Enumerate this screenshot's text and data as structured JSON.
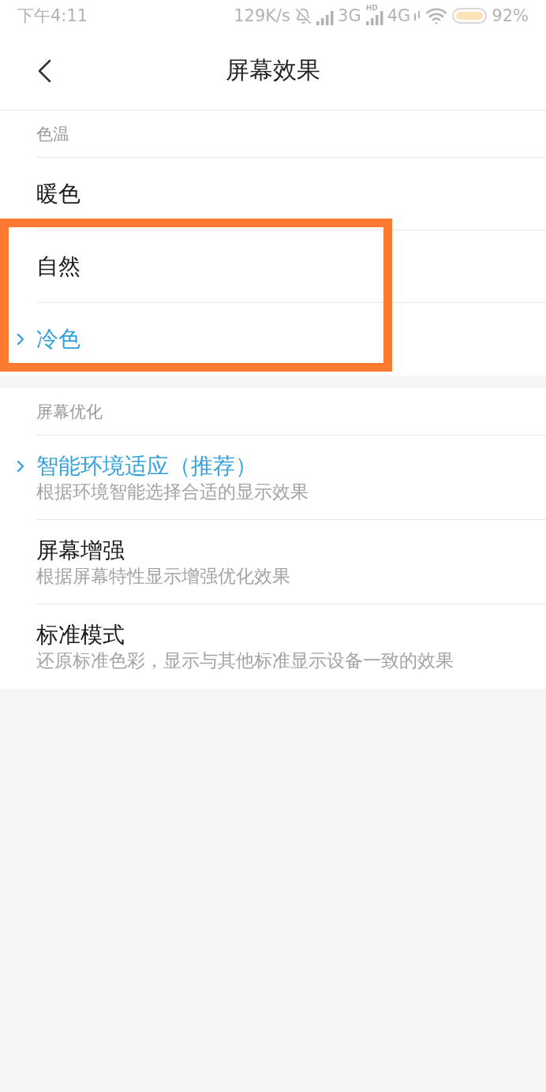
{
  "status_bar": {
    "time": "下午4:11",
    "speed": "129K/s",
    "sims": [
      {
        "network": "3G",
        "data_active": false
      },
      {
        "network": "4G",
        "hd": "HD",
        "data_active": true
      }
    ],
    "battery": "92%"
  },
  "header": {
    "title": "屏幕效果"
  },
  "sections": [
    {
      "title": "色温",
      "items": [
        {
          "title": "暖色",
          "selected": false,
          "highlighted": false
        },
        {
          "title": "自然",
          "selected": false,
          "highlighted": true
        },
        {
          "title": "冷色",
          "selected": true,
          "highlighted": true
        }
      ]
    },
    {
      "title": "屏幕优化",
      "items": [
        {
          "title": "智能环境适应（推荐）",
          "subtitle": "根据环境智能选择合适的显示效果",
          "selected": true
        },
        {
          "title": "屏幕增强",
          "subtitle": "根据屏幕特性显示增强优化效果",
          "selected": false
        },
        {
          "title": "标准模式",
          "subtitle": "还原标准色彩，显示与其他标准显示设备一致的效果",
          "selected": false
        }
      ]
    }
  ]
}
